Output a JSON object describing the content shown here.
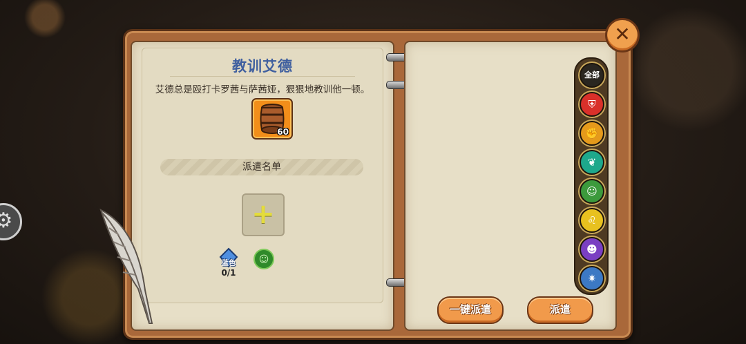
{
  "quest": {
    "title": "教训艾德",
    "description": "艾德总是殴打卡罗茜与萨茜娅，狠狠地教训他一顿。",
    "reward": {
      "icon": "barrel-icon",
      "count": "60"
    },
    "dispatch_list_label": "派遣名单",
    "requirement": {
      "rarity_label": "蓝色",
      "count": "0/1",
      "icon": "mask-icon"
    }
  },
  "filters": [
    {
      "label": "全部",
      "icon": "all-filter",
      "color": "#2a2620"
    },
    {
      "label": "",
      "icon": "sword-shield-icon",
      "color": "#d9302a"
    },
    {
      "label": "",
      "icon": "fist-icon",
      "color": "#e59a1b"
    },
    {
      "label": "",
      "icon": "leaf-icon",
      "color": "#1ea88b"
    },
    {
      "label": "",
      "icon": "mask-icon",
      "color": "#3c9a3c"
    },
    {
      "label": "",
      "icon": "lion-icon",
      "color": "#e8c11f"
    },
    {
      "label": "",
      "icon": "monkey-icon",
      "color": "#7a3fc2"
    },
    {
      "label": "",
      "icon": "compass-icon",
      "color": "#3c79c4"
    }
  ],
  "buttons": {
    "auto_dispatch": "一键派遣",
    "dispatch": "派遣"
  },
  "close_icon": "close-icon",
  "settings_icon": "gear-icon"
}
